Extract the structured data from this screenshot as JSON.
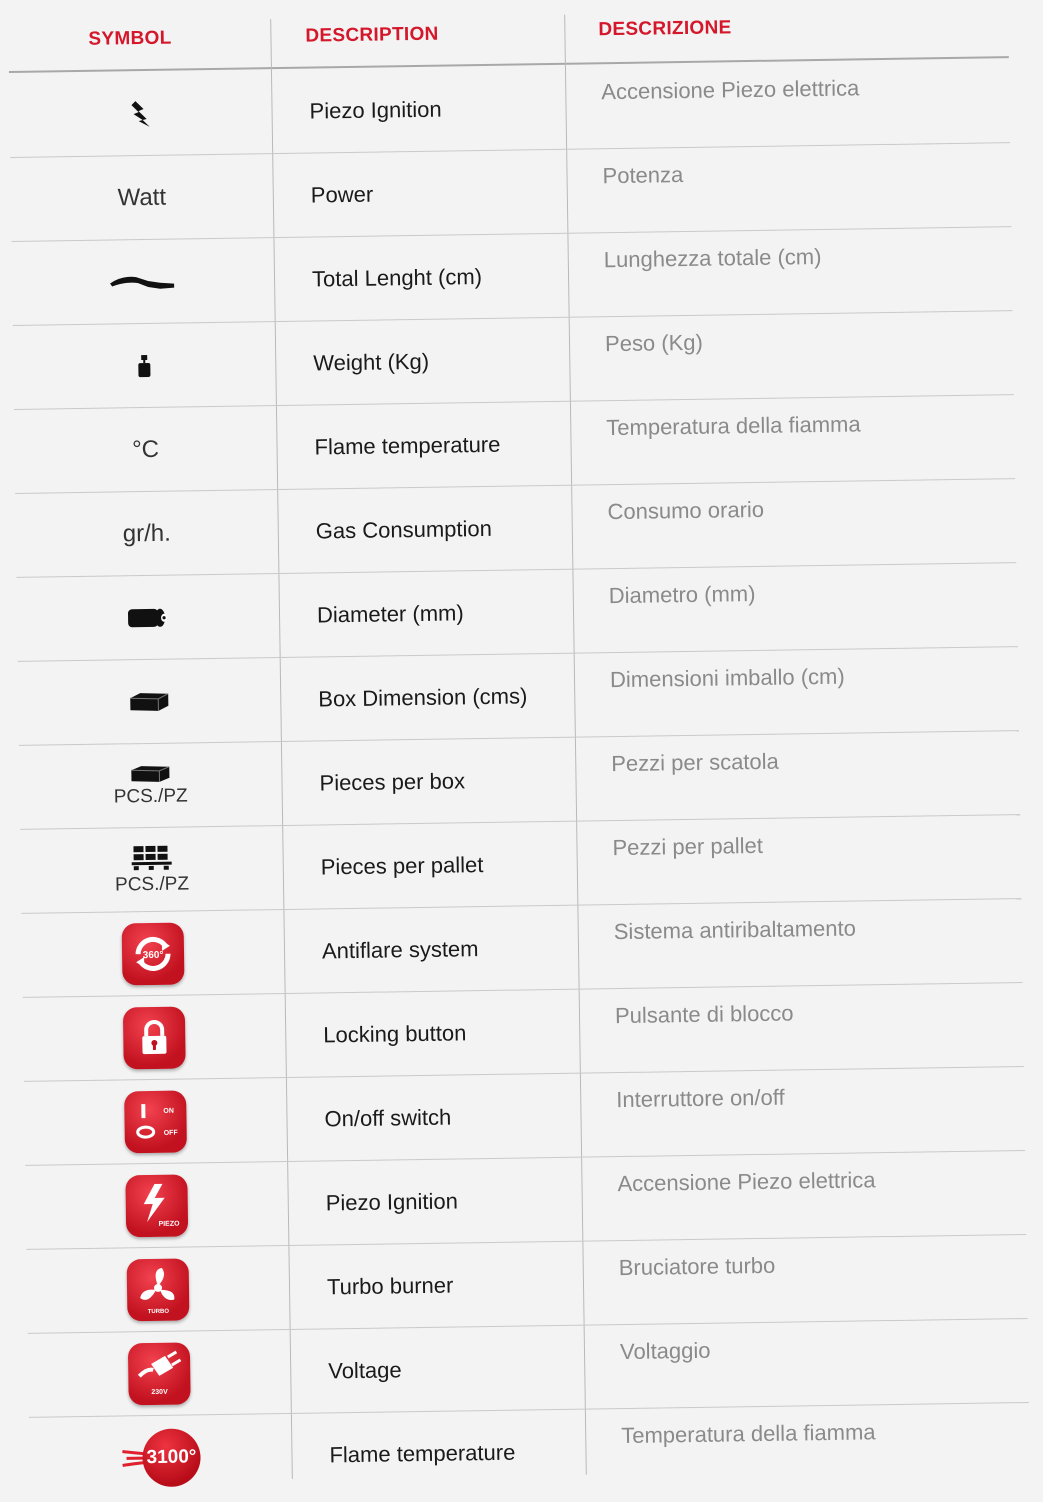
{
  "header": {
    "symbol": "SYMBOL",
    "description": "DESCRIPTION",
    "descrizione": "DESCRIZIONE"
  },
  "rows": [
    {
      "symbol_icon": "lightning-bolt-icon",
      "symbol_text": "",
      "symbol_sub": "",
      "en": "Piezo Ignition",
      "it": "Accensione Piezo elettrica"
    },
    {
      "symbol_icon": "",
      "symbol_text": "Watt",
      "symbol_sub": "",
      "en": "Power",
      "it": "Potenza"
    },
    {
      "symbol_icon": "torch-length-icon",
      "symbol_text": "",
      "symbol_sub": "",
      "en": "Total Lenght (cm)",
      "it": "Lunghezza totale (cm)"
    },
    {
      "symbol_icon": "weight-icon",
      "symbol_text": "",
      "symbol_sub": "",
      "en": "Weight (Kg)",
      "it": "Peso (Kg)"
    },
    {
      "symbol_icon": "",
      "symbol_text": "°C",
      "symbol_sub": "",
      "en": "Flame temperature",
      "it": "Temperatura della fiamma"
    },
    {
      "symbol_icon": "",
      "symbol_text": "gr/h.",
      "symbol_sub": "",
      "en": "Gas Consumption",
      "it": "Consumo orario"
    },
    {
      "symbol_icon": "cylinder-icon",
      "symbol_text": "",
      "symbol_sub": "",
      "en": "Diameter (mm)",
      "it": "Diametro (mm)"
    },
    {
      "symbol_icon": "box-icon",
      "symbol_text": "",
      "symbol_sub": "",
      "en": "Box Dimension (cms)",
      "it": "Dimensioni imballo (cm)"
    },
    {
      "symbol_icon": "box-icon",
      "symbol_text": "",
      "symbol_sub": "PCS./PZ",
      "en": "Pieces per box",
      "it": "Pezzi per scatola"
    },
    {
      "symbol_icon": "pallet-icon",
      "symbol_text": "",
      "symbol_sub": "PCS./PZ",
      "en": "Pieces per pallet",
      "it": "Pezzi per pallet"
    },
    {
      "symbol_icon": "antiflare-360-icon",
      "symbol_text": "",
      "symbol_sub": "",
      "en": "Antiflare system",
      "it": "Sistema antiribaltamento"
    },
    {
      "symbol_icon": "padlock-icon",
      "symbol_text": "",
      "symbol_sub": "",
      "en": "Locking button",
      "it": "Pulsante di blocco"
    },
    {
      "symbol_icon": "on-off-switch-icon",
      "symbol_text": "",
      "symbol_sub": "",
      "en": "On/off switch",
      "it": "Interruttore on/off"
    },
    {
      "symbol_icon": "piezo-badge-icon",
      "symbol_text": "",
      "symbol_sub": "",
      "en": "Piezo Ignition",
      "it": "Accensione Piezo elettrica"
    },
    {
      "symbol_icon": "turbo-fan-icon",
      "symbol_text": "",
      "symbol_sub": "",
      "en": "Turbo burner",
      "it": "Bruciatore turbo"
    },
    {
      "symbol_icon": "plug-230v-icon",
      "symbol_text": "",
      "symbol_sub": "",
      "en": "Voltage",
      "it": "Voltaggio"
    },
    {
      "symbol_icon": "flame-3100-icon",
      "symbol_text": "3100°",
      "symbol_sub": "",
      "en": "Flame temperature",
      "it": "Temperatura della fiamma"
    }
  ],
  "badge_labels": {
    "antiflare": "360°",
    "on": "ON",
    "off": "OFF",
    "piezo": "PIEZO",
    "turbo": "TURBO",
    "voltage": "230V"
  },
  "colors": {
    "accent": "#d4172a",
    "badge": "#d01b29",
    "italian_text": "#8a8a8a"
  }
}
